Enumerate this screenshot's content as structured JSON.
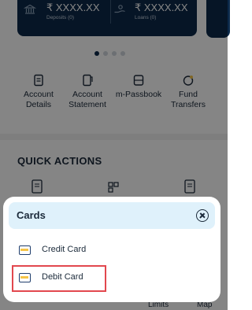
{
  "account_card": {
    "deposits": {
      "amount": "₹ XXXX.XX",
      "label": "Deposits (0)",
      "icon": "bank-icon"
    },
    "loans": {
      "amount": "₹ XXXX.XX",
      "label": "Loans (0)",
      "icon": "hand-coin-icon"
    }
  },
  "carousel": {
    "pages": 4,
    "active": 1
  },
  "quick_links": [
    {
      "label": "Account Details",
      "icon": "account-details-icon"
    },
    {
      "label": "Account Statement",
      "icon": "statement-icon"
    },
    {
      "label": "m-Passbook",
      "icon": "passbook-icon"
    },
    {
      "label": "Fund Transfers",
      "icon": "fund-transfer-icon"
    }
  ],
  "quick_actions": {
    "title": "QUICK ACTIONS"
  },
  "tabbar": {
    "limits": "Limits",
    "map": "Map"
  },
  "sheet": {
    "title": "Cards",
    "options": [
      {
        "label": "Credit Card",
        "icon": "credit-card-icon"
      },
      {
        "label": "Debit Card",
        "icon": "debit-card-icon",
        "highlighted": true
      }
    ]
  },
  "colors": {
    "brand_navy": "#0c2a4a",
    "header_tint": "#dff1fb",
    "card_yellow": "#f6c447",
    "highlight_red": "#e2474e"
  }
}
